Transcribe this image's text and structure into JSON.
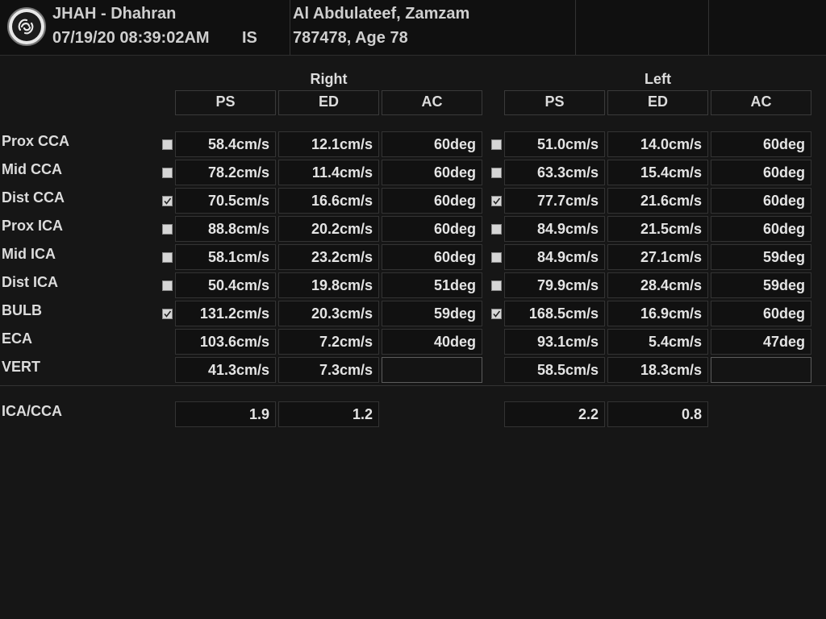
{
  "header": {
    "institution": "JHAH - Dhahran",
    "datetime": "07/19/20 08:39:02AM",
    "operator": "IS",
    "patient_name": "Al Abdulateef, Zamzam",
    "patient_id_age": "787478, Age 78"
  },
  "columns": {
    "right": "Right",
    "left": "Left",
    "sub": [
      "PS",
      "ED",
      "AC"
    ]
  },
  "rows": [
    {
      "label": "Prox CCA",
      "right": {
        "check": "unchecked",
        "ps": "58.4cm/s",
        "ed": "12.1cm/s",
        "ac": "60deg"
      },
      "left": {
        "check": "unchecked",
        "ps": "51.0cm/s",
        "ed": "14.0cm/s",
        "ac": "60deg"
      }
    },
    {
      "label": "Mid CCA",
      "right": {
        "check": "unchecked",
        "ps": "78.2cm/s",
        "ed": "11.4cm/s",
        "ac": "60deg"
      },
      "left": {
        "check": "unchecked",
        "ps": "63.3cm/s",
        "ed": "15.4cm/s",
        "ac": "60deg"
      }
    },
    {
      "label": "Dist CCA",
      "right": {
        "check": "checked",
        "ps": "70.5cm/s",
        "ed": "16.6cm/s",
        "ac": "60deg"
      },
      "left": {
        "check": "checked",
        "ps": "77.7cm/s",
        "ed": "21.6cm/s",
        "ac": "60deg"
      }
    },
    {
      "label": "Prox ICA",
      "right": {
        "check": "unchecked",
        "ps": "88.8cm/s",
        "ed": "20.2cm/s",
        "ac": "60deg"
      },
      "left": {
        "check": "unchecked",
        "ps": "84.9cm/s",
        "ed": "21.5cm/s",
        "ac": "60deg"
      }
    },
    {
      "label": "Mid ICA",
      "right": {
        "check": "unchecked",
        "ps": "58.1cm/s",
        "ed": "23.2cm/s",
        "ac": "60deg"
      },
      "left": {
        "check": "unchecked",
        "ps": "84.9cm/s",
        "ed": "27.1cm/s",
        "ac": "59deg"
      }
    },
    {
      "label": "Dist ICA",
      "right": {
        "check": "unchecked",
        "ps": "50.4cm/s",
        "ed": "19.8cm/s",
        "ac": "51deg"
      },
      "left": {
        "check": "unchecked",
        "ps": "79.9cm/s",
        "ed": "28.4cm/s",
        "ac": "59deg"
      }
    },
    {
      "label": "BULB",
      "right": {
        "check": "checked",
        "ps": "131.2cm/s",
        "ed": "20.3cm/s",
        "ac": "59deg"
      },
      "left": {
        "check": "checked",
        "ps": "168.5cm/s",
        "ed": "16.9cm/s",
        "ac": "60deg"
      }
    },
    {
      "label": "ECA",
      "right": {
        "check": "none",
        "ps": "103.6cm/s",
        "ed": "7.2cm/s",
        "ac": "40deg"
      },
      "left": {
        "check": "none",
        "ps": "93.1cm/s",
        "ed": "5.4cm/s",
        "ac": "47deg"
      }
    },
    {
      "label": "VERT",
      "right": {
        "check": "none",
        "ps": "41.3cm/s",
        "ed": "7.3cm/s",
        "ac": ""
      },
      "left": {
        "check": "none",
        "ps": "58.5cm/s",
        "ed": "18.3cm/s",
        "ac": ""
      }
    }
  ],
  "ratio": {
    "label": "ICA/CCA",
    "right": {
      "ps": "1.9",
      "ed": "1.2"
    },
    "left": {
      "ps": "2.2",
      "ed": "0.8"
    }
  },
  "icons": {
    "logo": "ge-logo-icon",
    "checkbox": "checkbox-icon"
  },
  "colors": {
    "background": "#161616",
    "text": "#dcdcdc",
    "cell_border": "#333333"
  }
}
